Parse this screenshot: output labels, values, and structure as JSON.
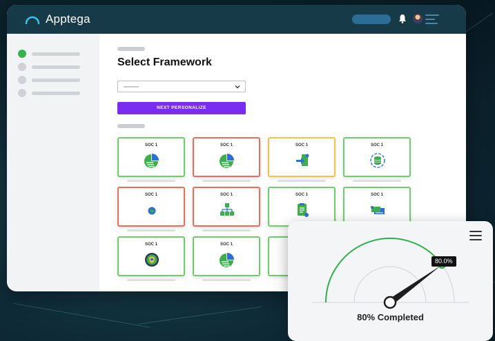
{
  "app": {
    "brand_name": "Apptega"
  },
  "page": {
    "title": "Select Framework",
    "next_button_label": "NEXT PERSONALIZE"
  },
  "frameworks": [
    {
      "label": "SOC 1",
      "status": "green",
      "icon": "pie-chart-icon"
    },
    {
      "label": "SOC 1",
      "status": "red",
      "icon": "pie-chart-icon"
    },
    {
      "label": "SOC 1",
      "status": "yellow",
      "icon": "document-arrow-icon"
    },
    {
      "label": "SOC 1",
      "status": "green",
      "icon": "database-sync-icon"
    },
    {
      "label": "SOC 1",
      "status": "red",
      "icon": "globe-icon"
    },
    {
      "label": "SOC 1",
      "status": "red",
      "icon": "hierarchy-icon"
    },
    {
      "label": "SOC 1",
      "status": "green",
      "icon": "clipboard-icon"
    },
    {
      "label": "SOC 1",
      "status": "green",
      "icon": "cards-icon"
    },
    {
      "label": "SOC 1",
      "status": "green",
      "icon": "globe-shield-icon"
    },
    {
      "label": "SOC 1",
      "status": "green",
      "icon": "pie-chart-icon"
    }
  ],
  "gauge": {
    "value_label": "80.0%",
    "caption": "80% Completed",
    "value_percent": 80
  },
  "colors": {
    "status_green": "#6ccf6a",
    "status_red": "#ef6b5a",
    "status_yellow": "#f2c443",
    "accent_purple": "#7a2cf0",
    "topbar": "#173a49",
    "gauge_green": "#2bb34a"
  }
}
